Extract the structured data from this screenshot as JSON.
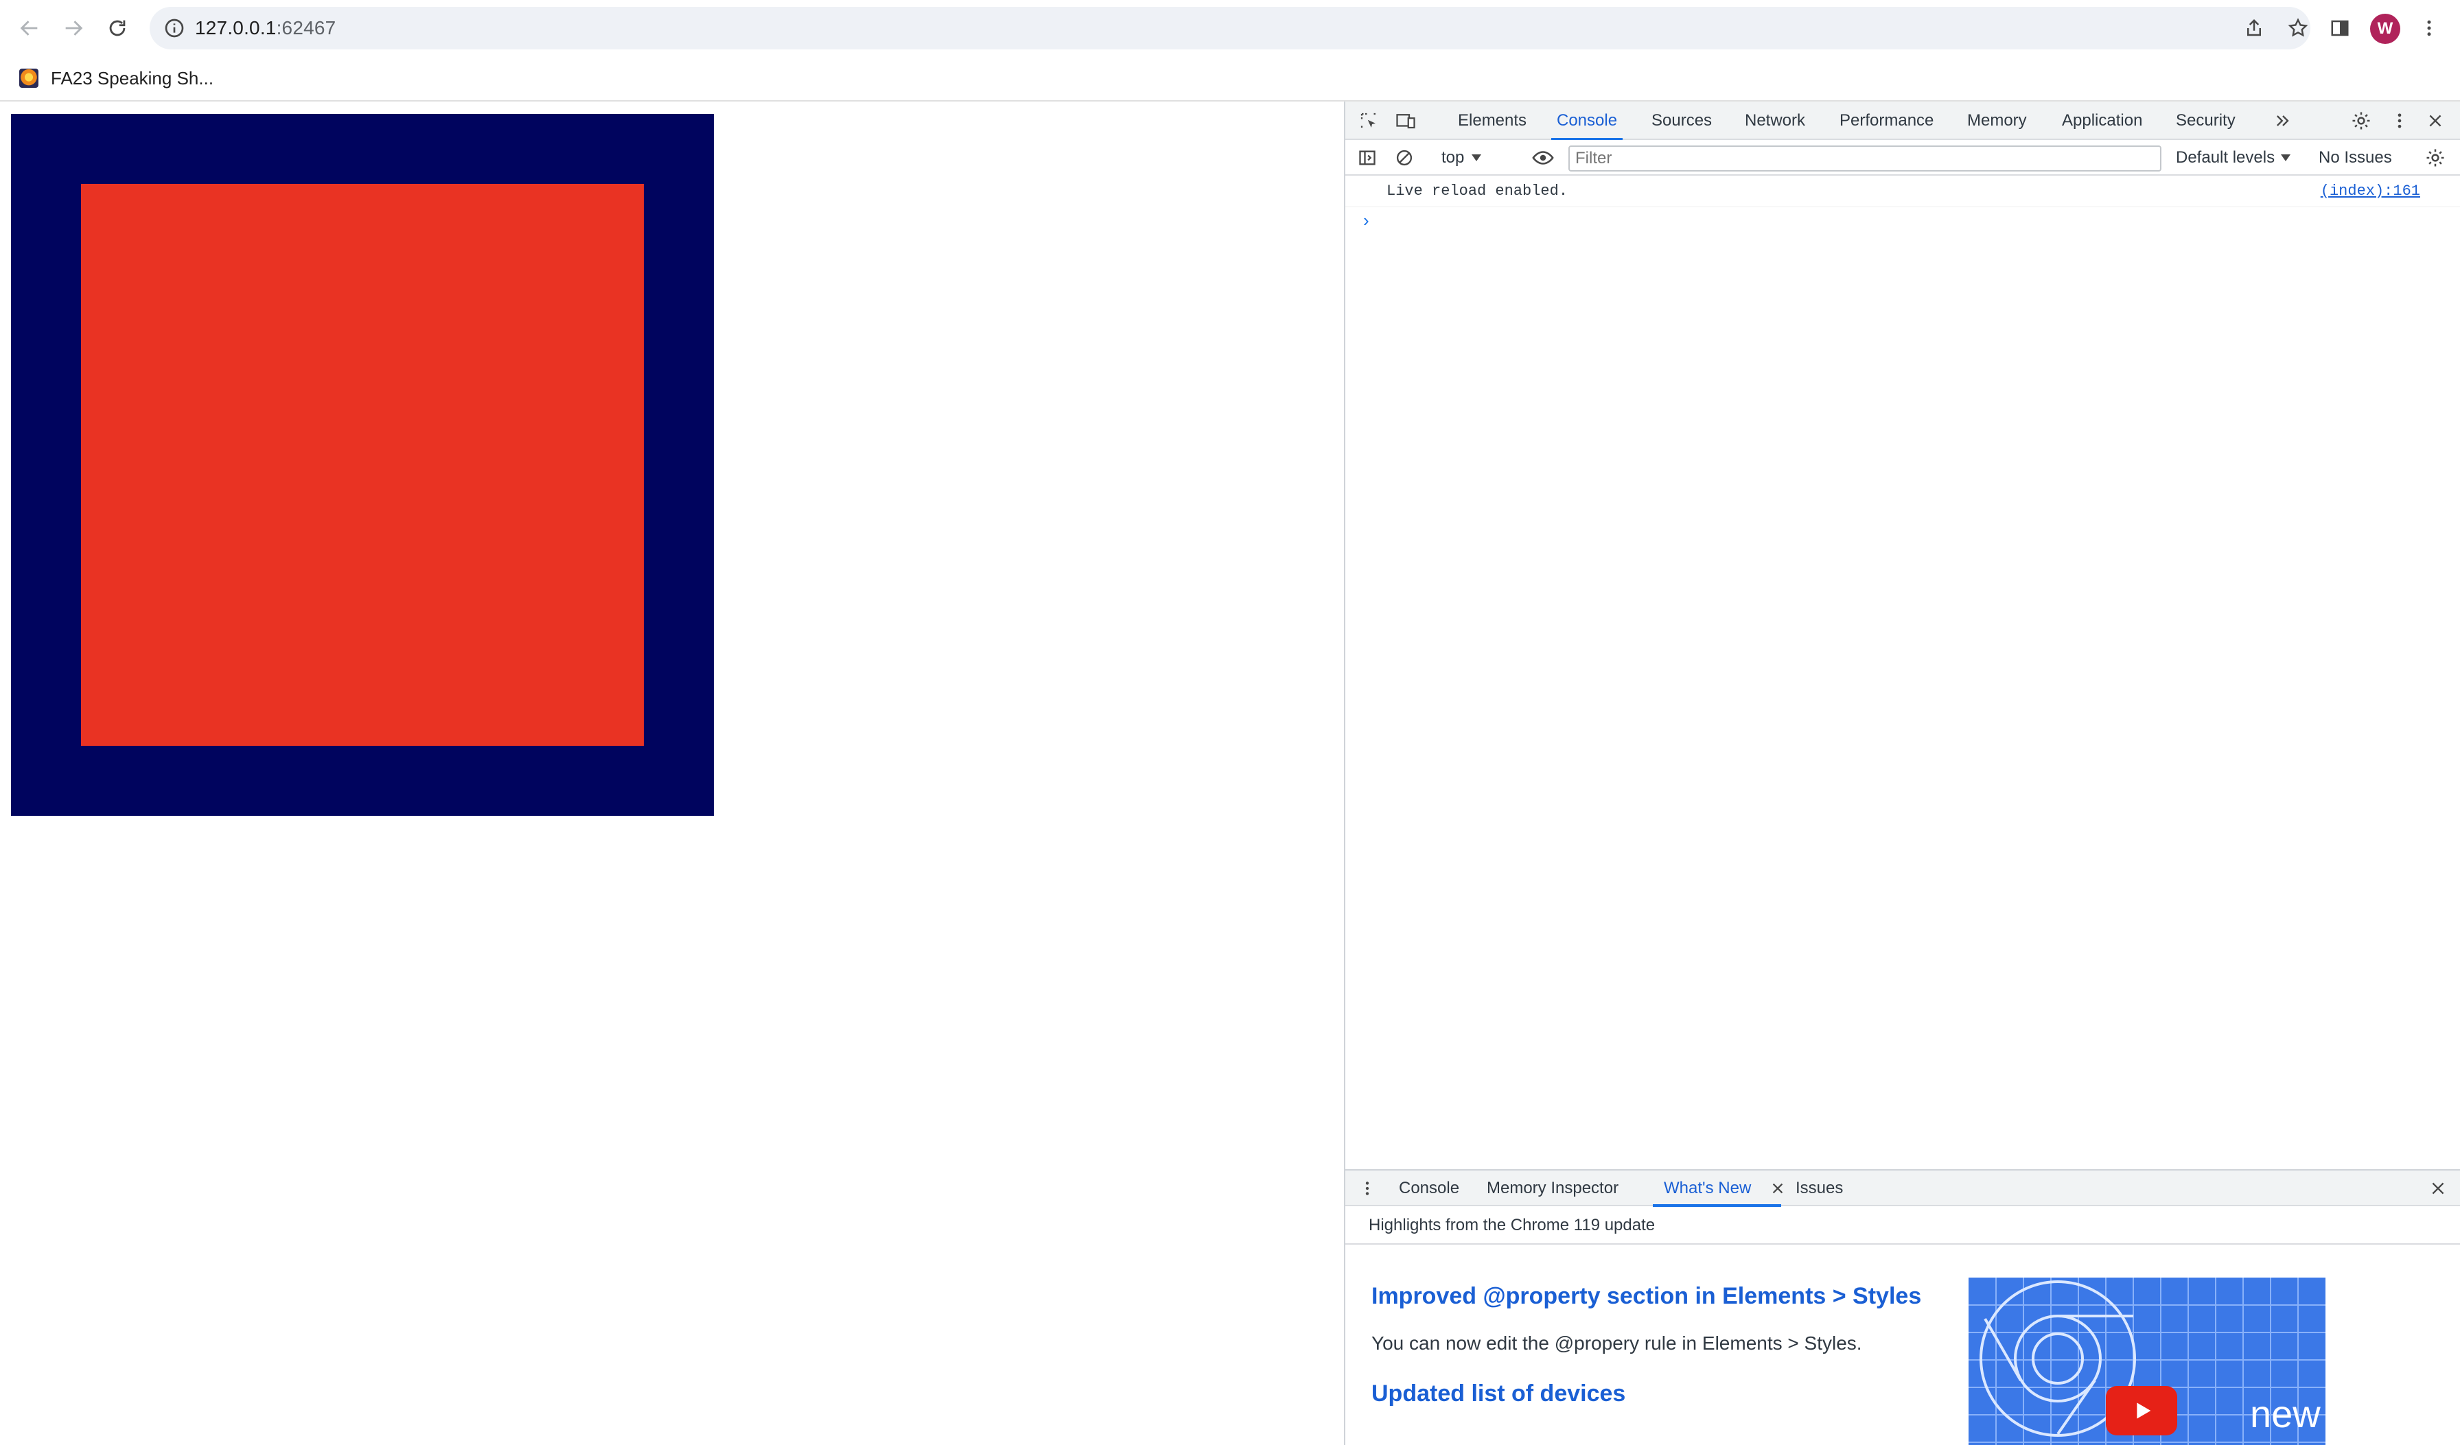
{
  "browser": {
    "url_host": "127.0.0.1",
    "url_port": ":62467"
  },
  "bookmarks": [
    {
      "label": "FA23 Speaking Sh..."
    }
  ],
  "profile": {
    "initial": "W",
    "color": "#b0235a"
  },
  "page": {
    "canvas_outer_color": "#00045e",
    "canvas_inner_color": "#e93323"
  },
  "devtools": {
    "tabs": [
      "Elements",
      "Console",
      "Sources",
      "Network",
      "Performance",
      "Memory",
      "Application",
      "Security"
    ],
    "active_tab": "Console",
    "console_bar": {
      "context": "top",
      "filter_placeholder": "Filter",
      "levels": "Default levels",
      "issues": "No Issues"
    },
    "messages": [
      {
        "text": "Live reload enabled.",
        "source": "(index):161"
      }
    ],
    "prompt": "›",
    "drawer": {
      "tabs": [
        "Console",
        "Memory Inspector",
        "What's New",
        "Issues"
      ],
      "active_tab": "What's New",
      "subtitle": "Highlights from the Chrome 119 update",
      "items": [
        {
          "heading": "Improved @property section in Elements > Styles",
          "body": "You can now edit the @propery rule in Elements > Styles."
        },
        {
          "heading": "Updated list of devices",
          "body": ""
        }
      ],
      "thumbnail_label": "new"
    }
  }
}
